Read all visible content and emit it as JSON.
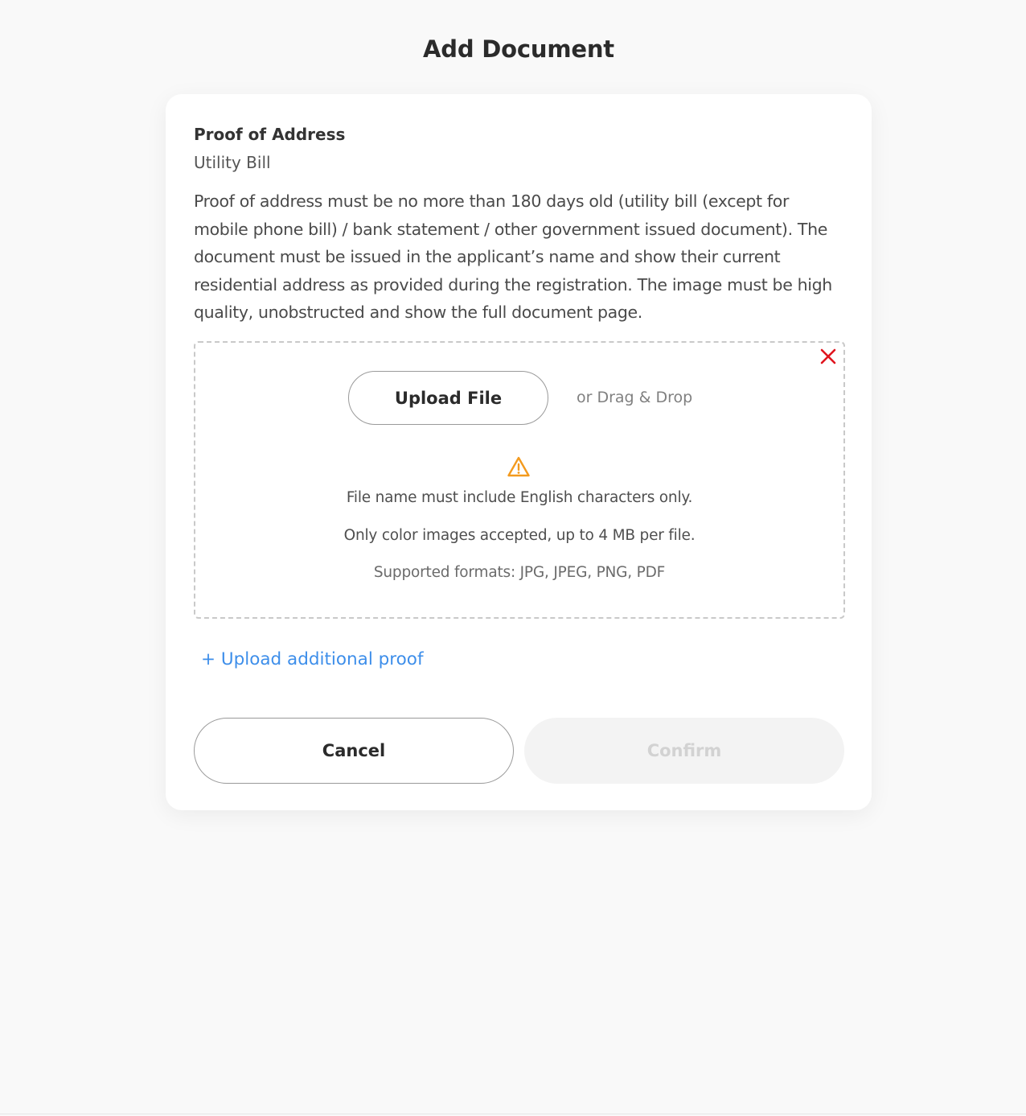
{
  "page": {
    "title": "Add Document"
  },
  "document": {
    "type": "Proof of Address",
    "subtype": "Utility Bill",
    "description": "Proof of address must be no more than 180 days old (utility bill (except for mobile phone bill) / bank statement / other government issued document). The document must be issued in the applicant’s name and show their current residential address as provided during the registration. The image must be high quality, unobstructed and show the full document page."
  },
  "upload": {
    "button_label": "Upload File",
    "drag_drop_text": "or Drag & Drop",
    "remove_icon": "close-icon",
    "warning_icon": "warning-triangle-icon",
    "requirements": [
      "File name must include English characters only.",
      "Only color images accepted, up to 4 MB per file.",
      "Supported formats: JPG, JPEG, PNG, PDF"
    ]
  },
  "add_proof": {
    "label": "+ Upload additional proof"
  },
  "actions": {
    "cancel_label": "Cancel",
    "confirm_label": "Confirm",
    "confirm_disabled": true
  },
  "colors": {
    "background": "#f9f9f9",
    "card": "#ffffff",
    "link": "#3d8eea",
    "warning": "#f39a1e",
    "remove": "#e0141e",
    "disabled_bg": "#f3f3f3",
    "disabled_text": "#d2d2d2"
  }
}
